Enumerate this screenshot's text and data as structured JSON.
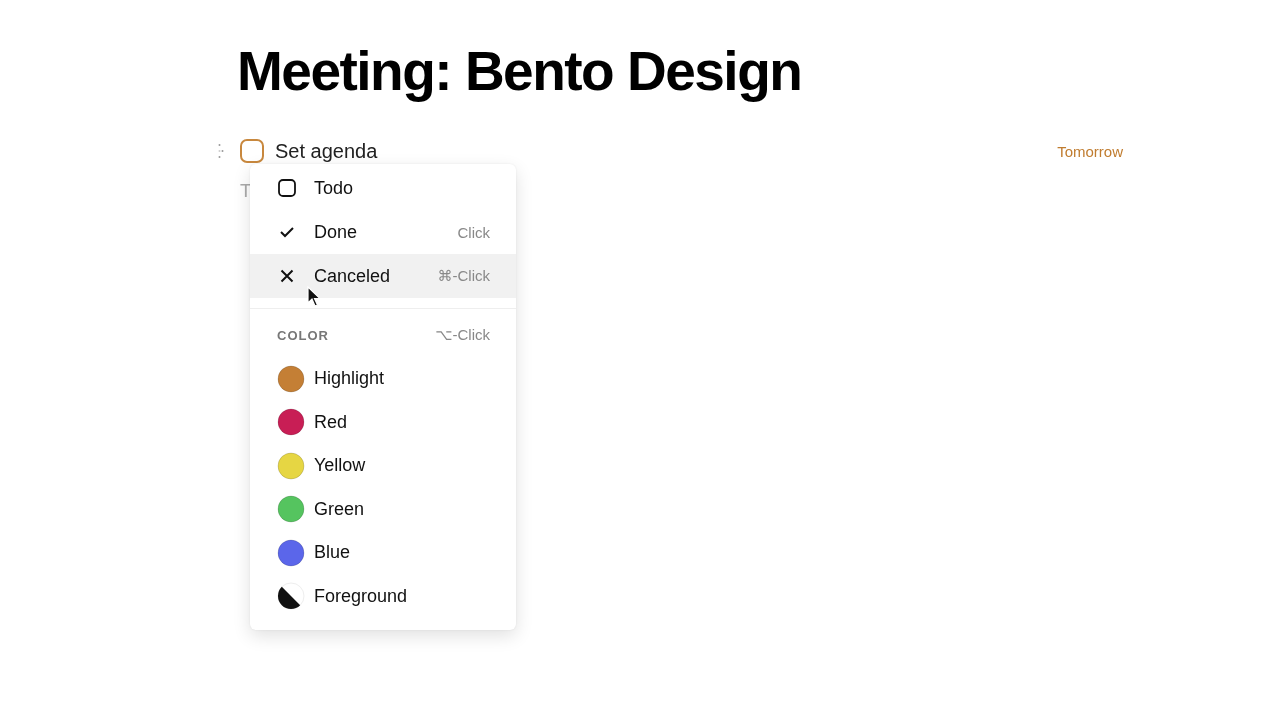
{
  "title": "Meeting: Bento Design",
  "task": {
    "text": "Set agenda",
    "checked": false,
    "due": "Tomorrow"
  },
  "next_line": {
    "text": "T"
  },
  "menu": {
    "status_options": [
      {
        "kind": "todo",
        "label": "Todo",
        "selected": false
      },
      {
        "kind": "done",
        "label": "Done",
        "shortcut": "Click",
        "selected": false
      },
      {
        "kind": "canceled",
        "label": "Canceled",
        "shortcut": "⌘-Click",
        "selected": true
      }
    ],
    "color_heading": "COLOR",
    "color_shortcut": "⌥-Click",
    "colors": [
      {
        "kind": "swatch",
        "label": "Highlight",
        "color": "#c47f35"
      },
      {
        "kind": "swatch",
        "label": "Red",
        "color": "#c81e55"
      },
      {
        "kind": "swatch",
        "label": "Yellow",
        "color": "#e6d643"
      },
      {
        "kind": "swatch",
        "label": "Green",
        "color": "#55c45f"
      },
      {
        "kind": "swatch",
        "label": "Blue",
        "color": "#5b66ea"
      },
      {
        "kind": "split",
        "label": "Foreground",
        "color": "#111111"
      }
    ]
  }
}
